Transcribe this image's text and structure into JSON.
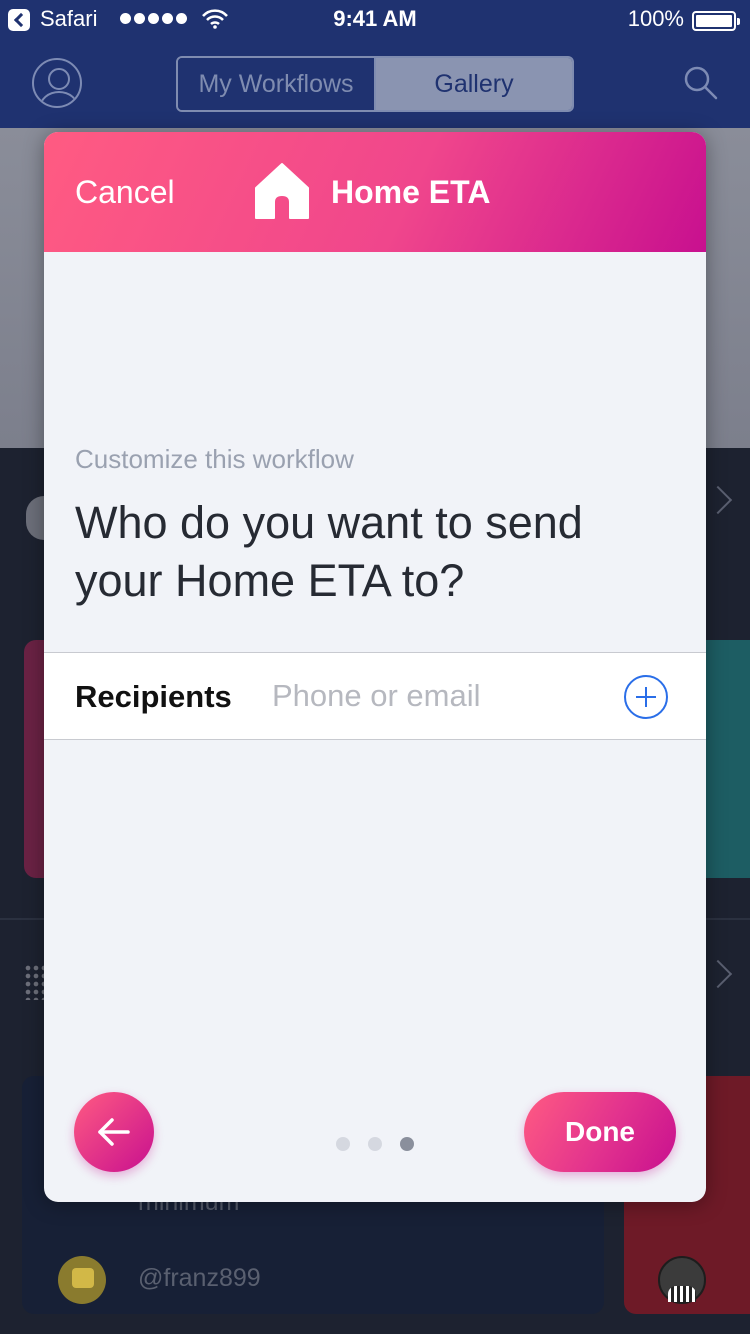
{
  "status_bar": {
    "back_app": "Safari",
    "time": "9:41 AM",
    "battery": "100%",
    "icons": [
      "back-icon",
      "signal-icon",
      "wifi-icon",
      "battery-icon"
    ]
  },
  "nav": {
    "segments": [
      "My Workflows",
      "Gallery"
    ],
    "selected_segment": "Gallery",
    "icons": [
      "profile-icon",
      "search-icon"
    ]
  },
  "background": {
    "minimum_text": "minimum",
    "username": "@franz899"
  },
  "modal": {
    "cancel_label": "Cancel",
    "title": "Home ETA",
    "title_icon": "home-icon",
    "subtitle": "Customize this workflow",
    "question": "Who do you want to send your Home ETA to?",
    "recipients": {
      "label": "Recipients",
      "placeholder": "Phone or email",
      "value": ""
    },
    "pagination": {
      "count": 3,
      "current": 3
    },
    "back_icon": "arrow-left-icon",
    "done_label": "Done"
  },
  "colors": {
    "nav_bg": "#1f3270",
    "header_gradient_start": "#ff5b82",
    "header_gradient_end": "#c8108f",
    "accent_blue": "#2a6ee8",
    "modal_bg": "#f1f3f8"
  }
}
